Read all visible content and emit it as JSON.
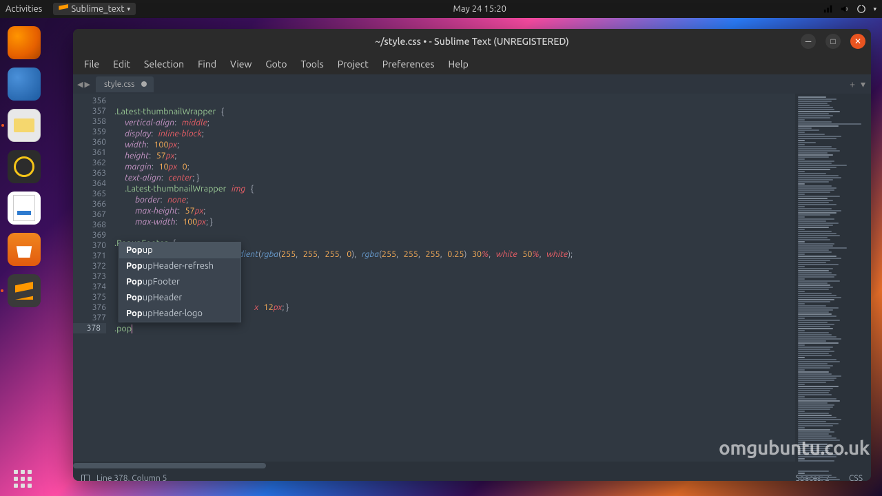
{
  "topbar": {
    "activities": "Activities",
    "app_name": "Sublime_text",
    "datetime": "May 24  15:20"
  },
  "window": {
    "title": "~/style.css • - Sublime Text (UNREGISTERED)"
  },
  "menubar": [
    "File",
    "Edit",
    "Selection",
    "Find",
    "View",
    "Goto",
    "Tools",
    "Project",
    "Preferences",
    "Help"
  ],
  "tab": {
    "name": "style.css"
  },
  "gutter_lines": [
    "356",
    "357",
    "358",
    "359",
    "360",
    "361",
    "362",
    "363",
    "364",
    "365",
    "366",
    "367",
    "368",
    "369",
    "370",
    "371",
    "372",
    "373",
    "374",
    "375",
    "376",
    "377",
    "378"
  ],
  "current_line_index": 22,
  "autocomplete": {
    "items": [
      {
        "prefix": "Pop",
        "rest": "up"
      },
      {
        "prefix": "Pop",
        "rest": "upHeader-refresh"
      },
      {
        "prefix": "Pop",
        "rest": "upFooter"
      },
      {
        "prefix": "Pop",
        "rest": "upHeader"
      },
      {
        "prefix": "Pop",
        "rest": "upHeader-logo"
      }
    ],
    "selected": 0
  },
  "typed": ".pop",
  "status": {
    "position": "Line 378, Column 5",
    "spaces": "Spaces: 2",
    "syntax": "CSS"
  },
  "watermark": "omgubuntu.co.uk"
}
